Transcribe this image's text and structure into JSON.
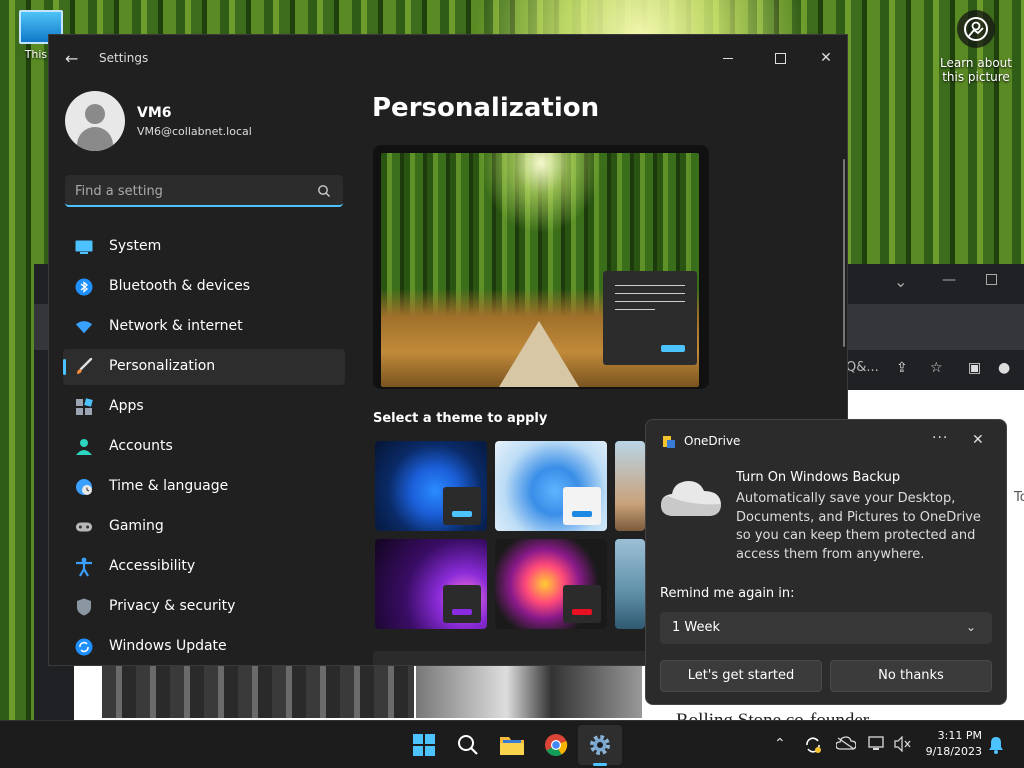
{
  "desktop": {
    "icon_label": "This P",
    "learn_label": "Learn about this picture"
  },
  "background_browser": {
    "url_fragment": "Q&...",
    "headline": "Rolling Stone co-founder",
    "fragment_to": "To"
  },
  "settings": {
    "window_title": "Settings",
    "user": {
      "name": "VM6",
      "email": "VM6@collabnet.local"
    },
    "search": {
      "placeholder": "Find a setting",
      "value": ""
    },
    "nav": [
      {
        "label": "System",
        "icon": "system-icon",
        "active": false
      },
      {
        "label": "Bluetooth & devices",
        "icon": "bluetooth-icon",
        "active": false
      },
      {
        "label": "Network & internet",
        "icon": "wifi-icon",
        "active": false
      },
      {
        "label": "Personalization",
        "icon": "brush-icon",
        "active": true
      },
      {
        "label": "Apps",
        "icon": "apps-icon",
        "active": false
      },
      {
        "label": "Accounts",
        "icon": "account-icon",
        "active": false
      },
      {
        "label": "Time & language",
        "icon": "clock-globe-icon",
        "active": false
      },
      {
        "label": "Gaming",
        "icon": "gamepad-icon",
        "active": false
      },
      {
        "label": "Accessibility",
        "icon": "accessibility-icon",
        "active": false
      },
      {
        "label": "Privacy & security",
        "icon": "shield-icon",
        "active": false
      },
      {
        "label": "Windows Update",
        "icon": "update-icon",
        "active": false
      }
    ],
    "page_title": "Personalization",
    "theme_heading": "Select a theme to apply"
  },
  "onedrive_toast": {
    "app_name": "OneDrive",
    "title": "Turn On Windows Backup",
    "body": "Automatically save your Desktop, Documents, and Pictures to OneDrive so you can keep them protected and access them from anywhere.",
    "remind_label": "Remind me again in:",
    "remind_value": "1 Week",
    "primary_button": "Let's get started",
    "secondary_button": "No thanks"
  },
  "taskbar": {
    "time": "3:11 PM",
    "date": "9/18/2023"
  },
  "colors": {
    "accent": "#4cc2ff",
    "window_bg": "#202020",
    "toast_bg": "#2b2b2b"
  }
}
